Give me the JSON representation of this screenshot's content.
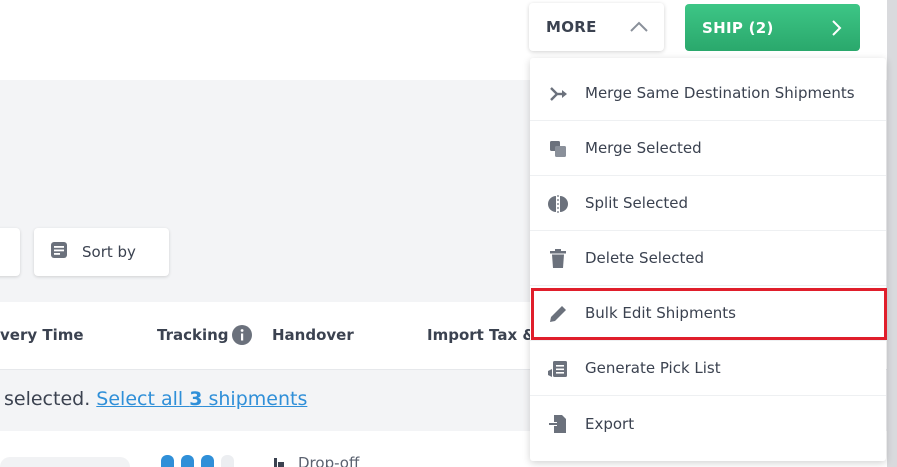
{
  "header": {
    "more_label": "MORE",
    "ship_label": "SHIP (2)"
  },
  "toolbar": {
    "sort_label": "Sort by"
  },
  "table": {
    "columns": [
      "very Time",
      "Tracking",
      "Handover",
      "Import Tax &"
    ]
  },
  "selection": {
    "prefix": "selected. ",
    "link_before": "Select all ",
    "link_count": "3",
    "link_after": " shipments"
  },
  "row": {
    "handover": "Drop-off"
  },
  "menu": {
    "items": [
      {
        "label": "Merge Same Destination Shipments",
        "icon": "merge-destination-icon"
      },
      {
        "label": "Merge Selected",
        "icon": "merge-selected-icon"
      },
      {
        "label": "Split Selected",
        "icon": "split-icon"
      },
      {
        "label": "Delete Selected",
        "icon": "trash-icon"
      },
      {
        "label": "Bulk Edit Shipments",
        "icon": "pencil-icon"
      },
      {
        "label": "Generate Pick List",
        "icon": "pick-list-icon"
      },
      {
        "label": "Export",
        "icon": "export-icon"
      }
    ]
  },
  "colors": {
    "accent_green": "#2aa86c",
    "link_blue": "#2f8fd8",
    "highlight_red": "#e01e2b"
  }
}
